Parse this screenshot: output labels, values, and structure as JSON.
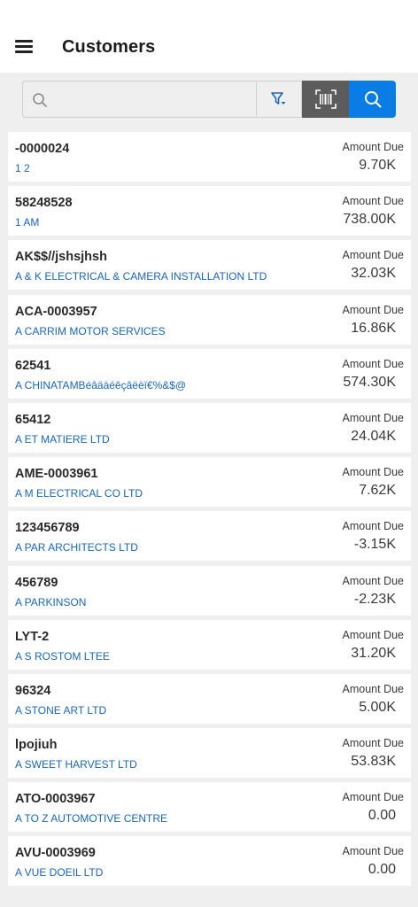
{
  "header": {
    "title": "Customers",
    "menu_icon": "hamburger-menu-icon"
  },
  "search": {
    "placeholder": "",
    "value": "",
    "icons": [
      "search-icon",
      "filter-icon",
      "barcode-scan-icon",
      "search-icon"
    ],
    "colors": {
      "barcode_button": "#5c5c5c",
      "search_button": "#0a7ce6"
    }
  },
  "customers": [
    {
      "code": "-0000024",
      "name": "1 2",
      "amount_label": "Amount Due",
      "amount": "9.70K"
    },
    {
      "code": "58248528",
      "name": "1 AM",
      "amount_label": "Amount Due",
      "amount": "738.00K"
    },
    {
      "code": "AK$$//jshsjhsh",
      "name": "A & K ELECTRICAL & CAMERA INSTALLATION LTD",
      "amount_label": "Amount Due",
      "amount": "32.03K"
    },
    {
      "code": "ACA-0003957",
      "name": "A CARRIM MOTOR SERVICES",
      "amount_label": "Amount Due",
      "amount": "16.86K"
    },
    {
      "code": "62541",
      "name": "A CHINATAMBéâäàéêçâëèï€%&$@",
      "amount_label": "Amount Due",
      "amount": "574.30K"
    },
    {
      "code": "65412",
      "name": "A ET MATIERE LTD",
      "amount_label": "Amount Due",
      "amount": "24.04K"
    },
    {
      "code": "AME-0003961",
      "name": "A M ELECTRICAL CO LTD",
      "amount_label": "Amount Due",
      "amount": "7.62K"
    },
    {
      "code": "123456789",
      "name": "A PAR ARCHITECTS LTD",
      "amount_label": "Amount Due",
      "amount": "-3.15K"
    },
    {
      "code": "456789",
      "name": "A PARKINSON",
      "amount_label": "Amount Due",
      "amount": "-2.23K"
    },
    {
      "code": "LYT-2",
      "name": "A S ROSTOM LTEE",
      "amount_label": "Amount Due",
      "amount": "31.20K"
    },
    {
      "code": "96324",
      "name": "A STONE ART LTD",
      "amount_label": "Amount Due",
      "amount": "5.00K"
    },
    {
      "code": "lpojiuh",
      "name": "A SWEET HARVEST LTD",
      "amount_label": "Amount Due",
      "amount": "53.83K"
    },
    {
      "code": "ATO-0003967",
      "name": "A TO Z AUTOMOTIVE CENTRE",
      "amount_label": "Amount Due",
      "amount": "0.00"
    },
    {
      "code": "AVU-0003969",
      "name": "A VUE DOEIL LTD",
      "amount_label": "Amount Due",
      "amount": "0.00"
    }
  ]
}
